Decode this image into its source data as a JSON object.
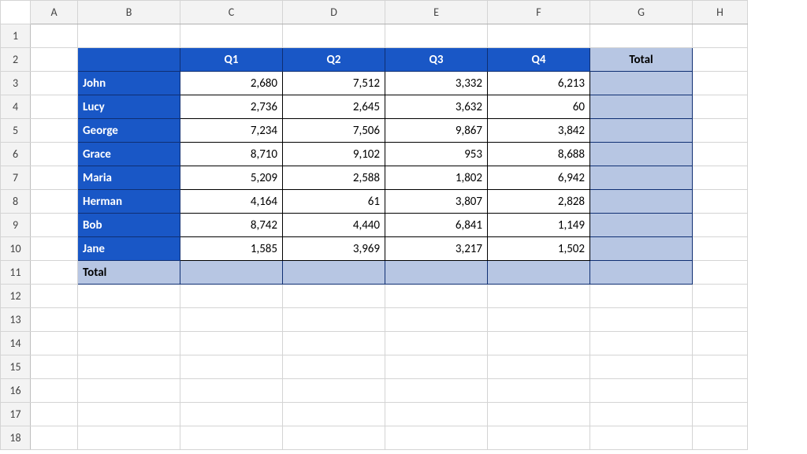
{
  "columns": [
    "A",
    "B",
    "C",
    "D",
    "E",
    "F",
    "G",
    "H"
  ],
  "rows": [
    "1",
    "2",
    "3",
    "4",
    "5",
    "6",
    "7",
    "8",
    "9",
    "10",
    "11",
    "12",
    "13",
    "14",
    "15",
    "16",
    "17",
    "18"
  ],
  "headers": {
    "q1": "Q1",
    "q2": "Q2",
    "q3": "Q3",
    "q4": "Q4",
    "total": "Total"
  },
  "names": [
    "John",
    "Lucy",
    "George",
    "Grace",
    "Maria",
    "Herman",
    "Bob",
    "Jane"
  ],
  "totalLabel": "Total",
  "data": [
    [
      "2,680",
      "7,512",
      "3,332",
      "6,213"
    ],
    [
      "2,736",
      "2,645",
      "3,632",
      "60"
    ],
    [
      "7,234",
      "7,506",
      "9,867",
      "3,842"
    ],
    [
      "8,710",
      "9,102",
      "953",
      "8,688"
    ],
    [
      "5,209",
      "2,588",
      "1,802",
      "6,942"
    ],
    [
      "4,164",
      "61",
      "3,807",
      "2,828"
    ],
    [
      "8,742",
      "4,440",
      "6,841",
      "1,149"
    ],
    [
      "1,585",
      "3,969",
      "3,217",
      "1,502"
    ]
  ],
  "chart_data": {
    "type": "table",
    "title": "",
    "columns": [
      "Q1",
      "Q2",
      "Q3",
      "Q4"
    ],
    "rows": [
      "John",
      "Lucy",
      "George",
      "Grace",
      "Maria",
      "Herman",
      "Bob",
      "Jane"
    ],
    "values": [
      [
        2680,
        7512,
        3332,
        6213
      ],
      [
        2736,
        2645,
        3632,
        60
      ],
      [
        7234,
        7506,
        9867,
        3842
      ],
      [
        8710,
        9102,
        953,
        8688
      ],
      [
        5209,
        2588,
        1802,
        6942
      ],
      [
        4164,
        61,
        3807,
        2828
      ],
      [
        8742,
        4440,
        6841,
        1149
      ],
      [
        1585,
        3969,
        3217,
        1502
      ]
    ]
  }
}
